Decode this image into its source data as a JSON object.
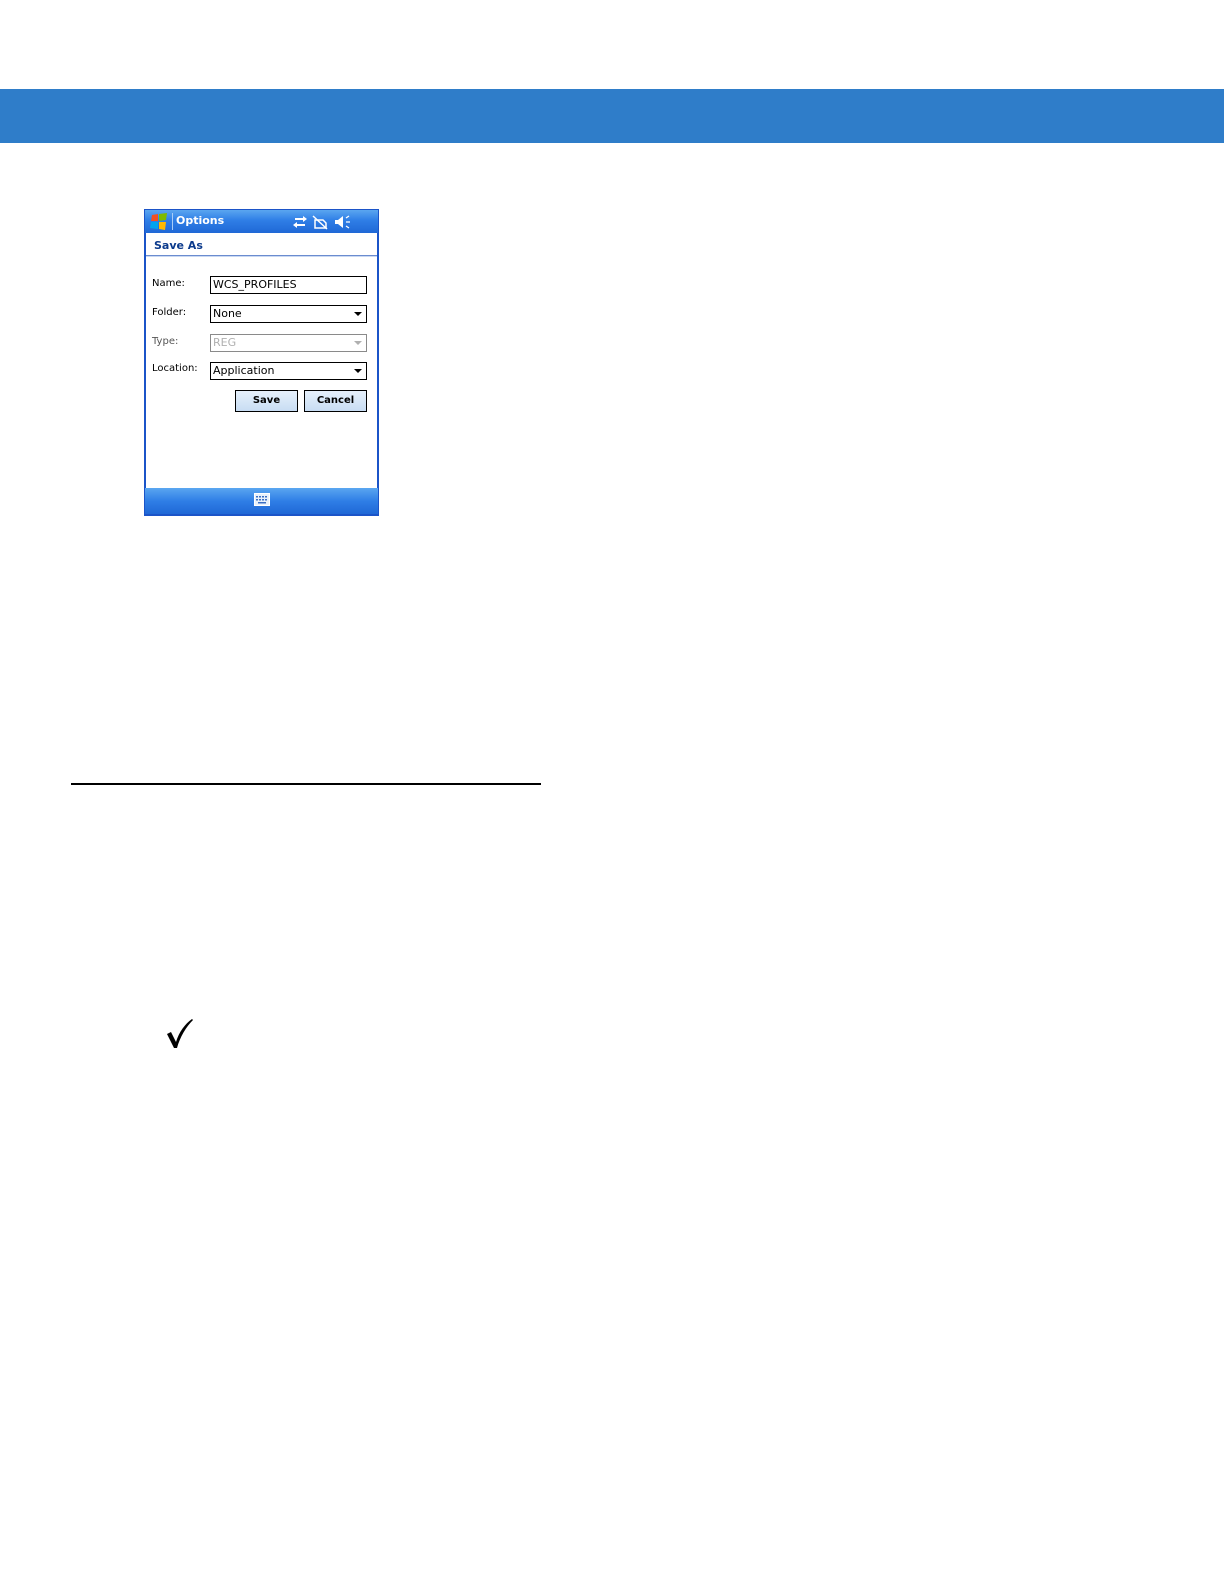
{
  "device": {
    "title": "Options",
    "subtitle": "Save As",
    "fields": {
      "name_label": "Name:",
      "name_value": "WCS_PROFILES",
      "folder_label": "Folder:",
      "folder_value": "None",
      "type_label": "Type:",
      "type_value": "REG",
      "location_label": "Location:",
      "location_value": "Application"
    },
    "buttons": {
      "save": "Save",
      "cancel": "Cancel"
    },
    "icons": [
      "windows-start-icon",
      "connectivity-icon",
      "battery-icon",
      "volume-icon",
      "keyboard-icon"
    ],
    "colors": {
      "title_bar": "#2f7ee6",
      "header_band": "#2f7dc9"
    }
  },
  "note": {
    "icon": "checkmark-icon"
  }
}
